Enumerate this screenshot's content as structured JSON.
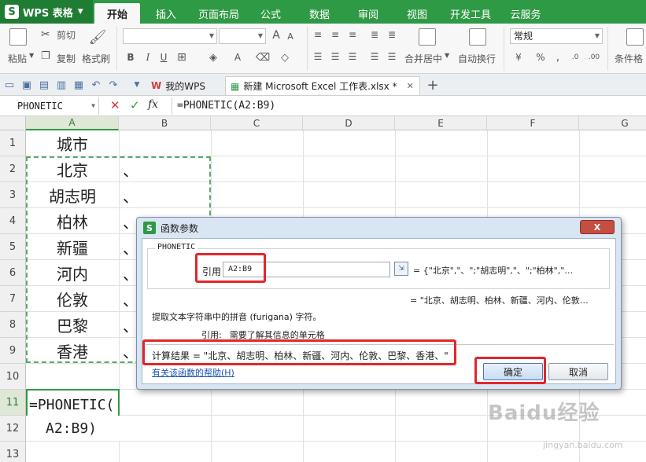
{
  "app": {
    "name": "WPS 表格"
  },
  "tabs": [
    "开始",
    "插入",
    "页面布局",
    "公式",
    "数据",
    "审阅",
    "视图",
    "开发工具",
    "云服务"
  ],
  "ribbon": {
    "cut": "剪切",
    "copy": "复制",
    "paste": "粘贴",
    "format_painter": "格式刷",
    "merge_center": "合并居中",
    "wrap_text": "自动换行",
    "number_format": "常规",
    "conditional_format": "条件格"
  },
  "doc_tabs": [
    {
      "label": "我的WPS"
    },
    {
      "label": "新建 Microsoft Excel 工作表.xlsx *"
    }
  ],
  "formula_bar": {
    "name_box": "PHONETIC",
    "fx": "fx",
    "formula": "=PHONETIC(A2:B9)"
  },
  "grid": {
    "columns": [
      "A",
      "B",
      "C",
      "D",
      "E",
      "F",
      "G"
    ],
    "rows": [
      "1",
      "2",
      "3",
      "4",
      "5",
      "6",
      "7",
      "8",
      "9",
      "10",
      "11",
      "12",
      "13"
    ],
    "colA": [
      "城市",
      "北京",
      "胡志明",
      "柏林",
      "新疆",
      "河内",
      "伦敦",
      "巴黎",
      "香港"
    ],
    "colB": [
      "",
      "、",
      "、",
      "、",
      "、",
      "、",
      "、",
      "、",
      "、"
    ],
    "edit_line1": "=PHONETIC(",
    "edit_line2": "A2:B9)"
  },
  "dialog": {
    "title": "函数参数",
    "close": "X",
    "function_name": "PHONETIC",
    "ref_label": "引用",
    "ref_value": "A2:B9",
    "ref_evaluated": "= {\"北京\",\"、\";\"胡志明\",\"、\";\"柏林\",\"…",
    "result_preview": "= \"北京、胡志明、柏林、新疆、河内、伦敦…",
    "description": "提取文本字符串中的拼音 (furigana) 字符。",
    "param_name": "引用:",
    "param_desc": "需要了解其信息的单元格",
    "calc_result": "计算结果 = \"北京、胡志明、柏林、新疆、河内、伦敦、巴黎、香港、\"",
    "help_link": "有关该函数的帮助(H)",
    "ok": "确定",
    "cancel": "取消"
  },
  "watermark": {
    "main": "Baidu经验",
    "sub": "jingyan.baidu.com"
  },
  "colors": {
    "accent": "#2f9a45",
    "highlight": "#e3262b",
    "dialog_bg": "#d8e6f3"
  }
}
